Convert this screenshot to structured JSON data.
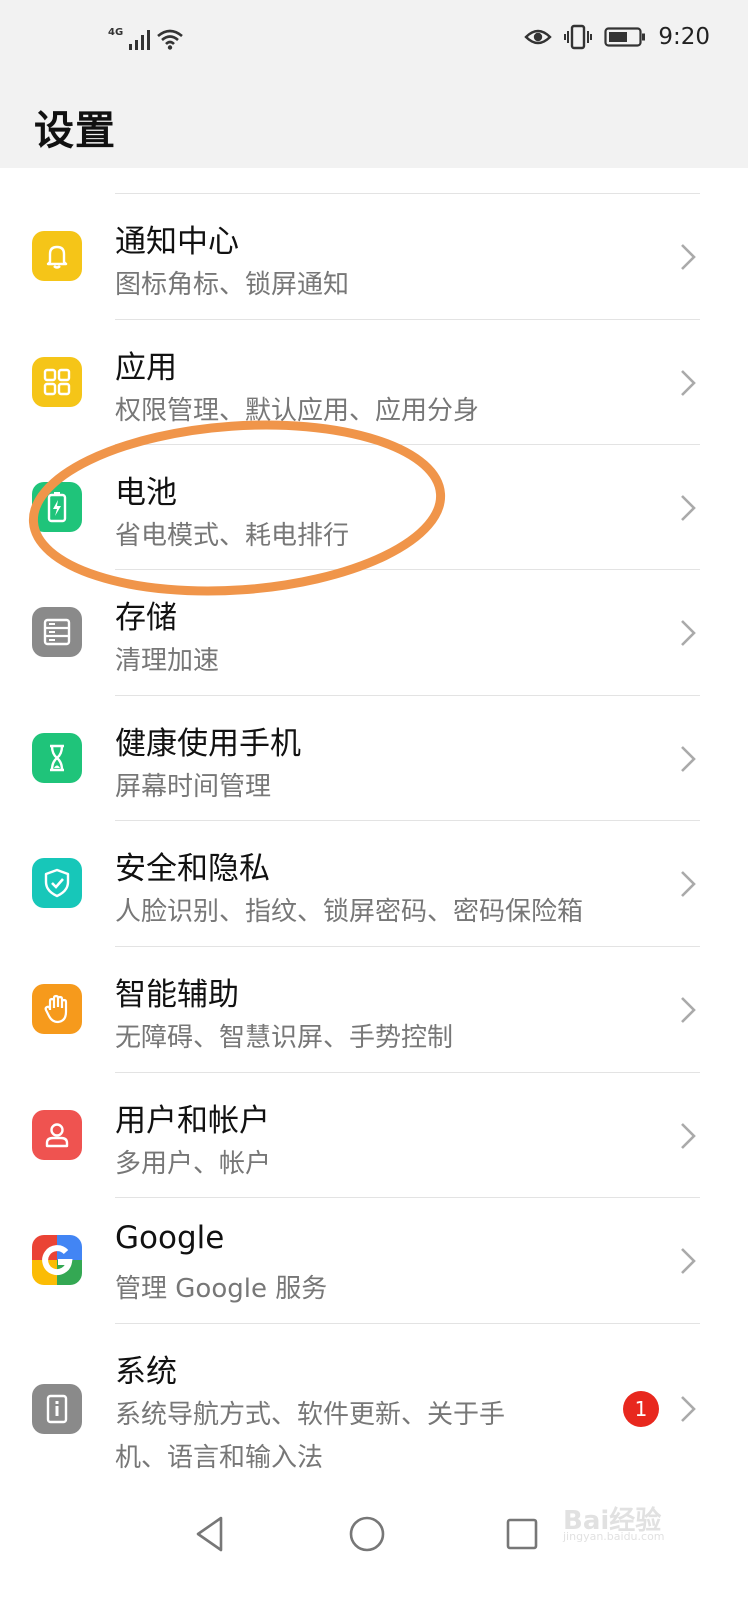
{
  "status_bar": {
    "network": "4G",
    "time": "9:20",
    "icons": [
      "signal-icon",
      "wifi-icon",
      "eye-comfort-icon",
      "vibrate-icon",
      "battery-icon"
    ]
  },
  "header": {
    "title": "设置"
  },
  "items": [
    {
      "title": "通知中心",
      "subtitle": "图标角标、锁屏通知",
      "icon": "bell-icon",
      "color": "#f5c518"
    },
    {
      "title": "应用",
      "subtitle": "权限管理、默认应用、应用分身",
      "icon": "apps-grid-icon",
      "color": "#f5c518"
    },
    {
      "title": "电池",
      "subtitle": "省电模式、耗电排行",
      "icon": "battery-charging-icon",
      "color": "#1fc47a"
    },
    {
      "title": "存储",
      "subtitle": "清理加速",
      "icon": "storage-icon",
      "color": "#8a8a8a"
    },
    {
      "title": "健康使用手机",
      "subtitle": "屏幕时间管理",
      "icon": "hourglass-icon",
      "color": "#1fc47a"
    },
    {
      "title": "安全和隐私",
      "subtitle": "人脸识别、指纹、锁屏密码、密码保险箱",
      "icon": "shield-check-icon",
      "color": "#17c7b9"
    },
    {
      "title": "智能辅助",
      "subtitle": "无障碍、智慧识屏、手势控制",
      "icon": "hand-icon",
      "color": "#f69a1c"
    },
    {
      "title": "用户和帐户",
      "subtitle": "多用户、帐户",
      "icon": "user-icon",
      "color": "#ef5350"
    },
    {
      "title": "Google",
      "subtitle": "管理 Google 服务",
      "icon": "google-icon",
      "color": "#ffffff"
    },
    {
      "title": "系统",
      "subtitle_lines": [
        "系统导航方式、软件更新、关于手",
        "机、语言和输入法"
      ],
      "icon": "system-info-icon",
      "color": "#8a8a8a",
      "badge": "1"
    }
  ],
  "nav_bar": {
    "icons": [
      "back-icon",
      "home-icon",
      "recents-icon"
    ]
  },
  "watermark": {
    "text": "Bai经验",
    "url": "jingyan.baidu.com"
  },
  "annotation": {
    "color": "#f0954a"
  }
}
